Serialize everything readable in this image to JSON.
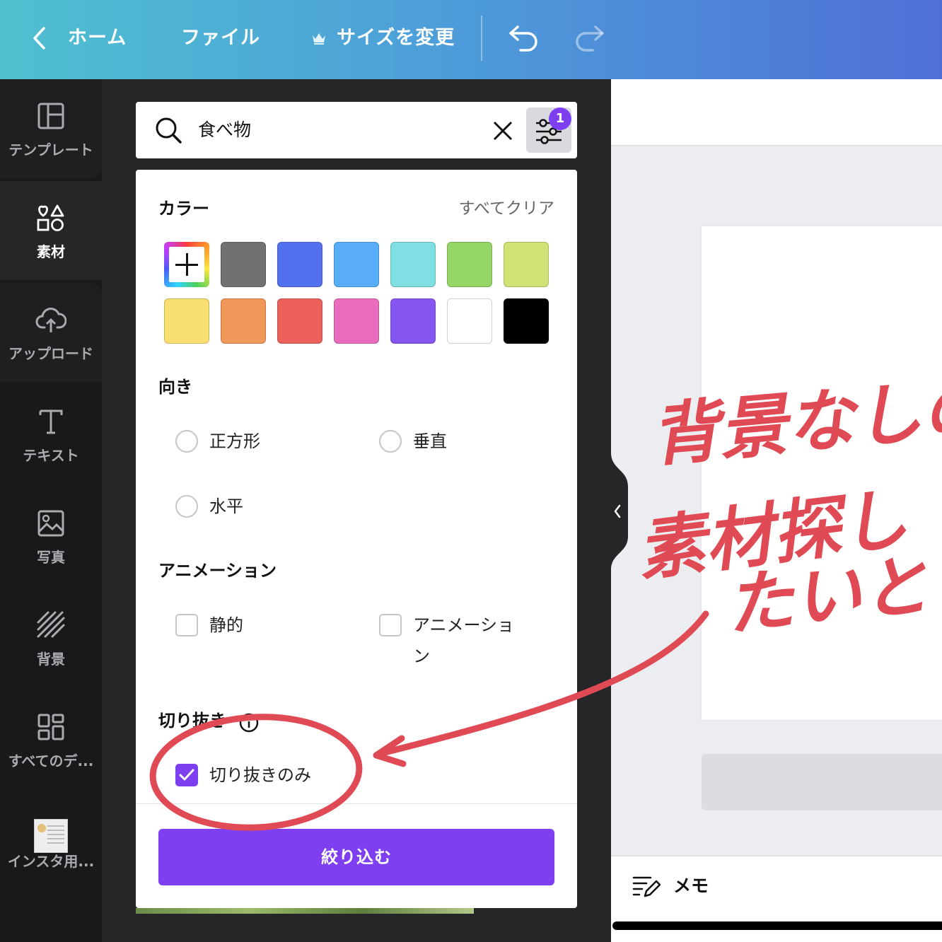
{
  "topbar": {
    "home_label": "ホーム",
    "file_label": "ファイル",
    "resize_label": "サイズを変更",
    "icons": [
      "chevron-left-icon",
      "crown-icon",
      "undo-icon",
      "redo-icon"
    ]
  },
  "sidebar": {
    "items": [
      {
        "label": "テンプレート",
        "icon": "template-icon"
      },
      {
        "label": "素材",
        "icon": "elements-icon"
      },
      {
        "label": "アップロード",
        "icon": "cloud-upload-icon"
      },
      {
        "label": "テキスト",
        "icon": "text-icon"
      },
      {
        "label": "写真",
        "icon": "photo-icon"
      },
      {
        "label": "背景",
        "icon": "background-icon"
      },
      {
        "label": "すべてのデ...",
        "icon": "all-designs-icon"
      },
      {
        "label": "インスタ用..."
      }
    ]
  },
  "search": {
    "value": "食べ物",
    "filter_count": "1"
  },
  "filters": {
    "color": {
      "title": "カラー",
      "clear_all": "すべてクリア",
      "swatches": [
        "#717171",
        "#5270ee",
        "#5aaef7",
        "#80dfe3",
        "#93d566",
        "#d1e176",
        "#f9de72",
        "#f0975a",
        "#ec615c",
        "#ea6cbd",
        "#8555f0",
        "#ffffff",
        "#000000"
      ]
    },
    "orientation": {
      "title": "向き",
      "options": [
        "正方形",
        "垂直",
        "水平"
      ]
    },
    "animation": {
      "title": "アニメーション",
      "options": [
        "静的",
        "アニメーショ",
        "ン"
      ]
    },
    "cutout": {
      "title": "切り抜き",
      "option": "切り抜きのみ",
      "checked": true
    },
    "apply_label": "絞り込む"
  },
  "bottom": {
    "memo_label": "メモ"
  },
  "colors": {
    "accent": "#7d3ff0",
    "annotation": "#e04a55"
  }
}
